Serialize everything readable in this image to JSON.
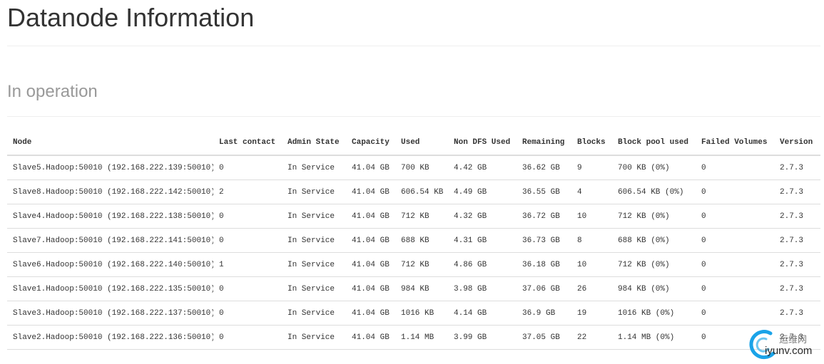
{
  "page": {
    "title": "Datanode Information",
    "section_title": "In operation"
  },
  "table": {
    "headers": [
      "Node",
      "Last contact",
      "Admin State",
      "Capacity",
      "Used",
      "Non DFS Used",
      "Remaining",
      "Blocks",
      "Block pool used",
      "Failed Volumes",
      "Version"
    ],
    "rows": [
      [
        "Slave5.Hadoop:50010 (192.168.222.139:50010)",
        "0",
        "In Service",
        "41.04 GB",
        "700 KB",
        "4.42 GB",
        "36.62 GB",
        "9",
        "700 KB (0%)",
        "0",
        "2.7.3"
      ],
      [
        "Slave8.Hadoop:50010 (192.168.222.142:50010)",
        "2",
        "In Service",
        "41.04 GB",
        "606.54 KB",
        "4.49 GB",
        "36.55 GB",
        "4",
        "606.54 KB (0%)",
        "0",
        "2.7.3"
      ],
      [
        "Slave4.Hadoop:50010 (192.168.222.138:50010)",
        "0",
        "In Service",
        "41.04 GB",
        "712 KB",
        "4.32 GB",
        "36.72 GB",
        "10",
        "712 KB (0%)",
        "0",
        "2.7.3"
      ],
      [
        "Slave7.Hadoop:50010 (192.168.222.141:50010)",
        "0",
        "In Service",
        "41.04 GB",
        "688 KB",
        "4.31 GB",
        "36.73 GB",
        "8",
        "688 KB (0%)",
        "0",
        "2.7.3"
      ],
      [
        "Slave6.Hadoop:50010 (192.168.222.140:50010)",
        "1",
        "In Service",
        "41.04 GB",
        "712 KB",
        "4.86 GB",
        "36.18 GB",
        "10",
        "712 KB (0%)",
        "0",
        "2.7.3"
      ],
      [
        "Slave1.Hadoop:50010 (192.168.222.135:50010)",
        "0",
        "In Service",
        "41.04 GB",
        "984 KB",
        "3.98 GB",
        "37.06 GB",
        "26",
        "984 KB (0%)",
        "0",
        "2.7.3"
      ],
      [
        "Slave3.Hadoop:50010 (192.168.222.137:50010)",
        "0",
        "In Service",
        "41.04 GB",
        "1016 KB",
        "4.14 GB",
        "36.9 GB",
        "19",
        "1016 KB (0%)",
        "0",
        "2.7.3"
      ],
      [
        "Slave2.Hadoop:50010 (192.168.222.136:50010)",
        "0",
        "In Service",
        "41.04 GB",
        "1.14 MB",
        "3.99 GB",
        "37.05 GB",
        "22",
        "1.14 MB (0%)",
        "0",
        "2.7.3"
      ]
    ]
  },
  "watermark": {
    "text_cn": "运维网",
    "text_en": "iyunv.com",
    "icon": "swirl-logo-icon"
  },
  "colors": {
    "title": "#333333",
    "section_title": "#999999",
    "border": "#dddddd",
    "logo_blue": "#1aa3e8"
  }
}
